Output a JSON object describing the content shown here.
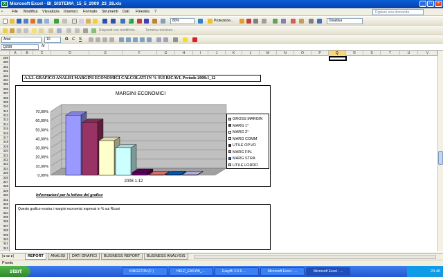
{
  "window": {
    "title": "Microsoft Excel - BI_SISTEMA_15_5_2009_23_28.xls"
  },
  "menu": [
    "File",
    "Modifica",
    "Visualizza",
    "Inserisci",
    "Formato",
    "Strumenti",
    "Dati",
    "Finestra",
    "?"
  ],
  "ask_placeholder": "Digitare una domanda.",
  "toolbar": {
    "zoom": "80%",
    "protezione": "Protezione...",
    "disattiva": "Disattiva",
    "reply_label": "Rispondi con modifiche...",
    "end_review": "Termina revisione..."
  },
  "format": {
    "font": "Arial",
    "size": "10"
  },
  "namebox": "Q299",
  "columns": [
    "A",
    "B",
    "C",
    "D",
    "E",
    "F",
    "G",
    "H",
    "I",
    "J",
    "K",
    "L",
    "M",
    "N",
    "O",
    "P",
    "Q",
    "R",
    "S",
    "T",
    "U",
    "V"
  ],
  "rows": [
    "299",
    "300",
    "301",
    "302",
    "303",
    "304",
    "305",
    "306",
    "307",
    "308",
    "309",
    "310",
    "311",
    "312",
    "313",
    "314",
    "315",
    "316",
    "317",
    "318",
    "319",
    "320",
    "321",
    "322",
    "323",
    "324",
    "325",
    "326",
    "327",
    "328",
    "329",
    "330",
    "331",
    "332",
    "333",
    "334",
    "335",
    "336",
    "337",
    "338",
    "339",
    "340",
    "341",
    "342",
    "343"
  ],
  "section_title": "A.3.3. GRAFICO ANALISI MARGINI ECONOMICI CALCOLATI IN % SUI RICAVI, Periodo 2008:1_12",
  "chart_data": {
    "type": "bar",
    "title": "MARGINI ECONOMICI",
    "categories": [
      "2008 1-12"
    ],
    "yticks": [
      "70,00%",
      "60,00%",
      "50,00%",
      "40,00%",
      "30,00%",
      "20,00%",
      "10,00%",
      "0,00%"
    ],
    "ylim": [
      0,
      70
    ],
    "series": [
      {
        "name": "GROSS MARGIN",
        "values": [
          66
        ],
        "color": "#9999ff"
      },
      {
        "name": "MARG 1°",
        "values": [
          58
        ],
        "color": "#993366"
      },
      {
        "name": "MARG 2°",
        "values": [
          38
        ],
        "color": "#ffffcc"
      },
      {
        "name": "MARG COMM",
        "values": [
          30
        ],
        "color": "#ccffff"
      },
      {
        "name": "UTILE OP.VO",
        "values": [
          3
        ],
        "color": "#660066"
      },
      {
        "name": "MARG FIN.",
        "values": [
          0.5
        ],
        "color": "#ff8080"
      },
      {
        "name": "MARG STRA",
        "values": [
          0.5
        ],
        "color": "#0066cc"
      },
      {
        "name": "UTILE LORDO",
        "values": [
          0.5
        ],
        "color": "#ccccff"
      }
    ]
  },
  "info_title": "Informazioni per la lettura del grafico",
  "info_text": "Questo grafico mostra i margini economici espressi in % sui Ricavi",
  "sheet_tabs": [
    "REPORT",
    "ANALISI",
    "DATI GRAFICI",
    "BUSINESS REPORT",
    "BUSINESS ANALYSIS"
  ],
  "status": "Pronto",
  "taskbar": {
    "start": "start",
    "tasks": [
      "KINGSTON (F:)",
      "HELP_EASYBI_...",
      "EasyBI  2.0.6 ...",
      "Microsoft Excel - ...",
      "Microsoft Excel - ..."
    ],
    "clock": "23.46"
  }
}
